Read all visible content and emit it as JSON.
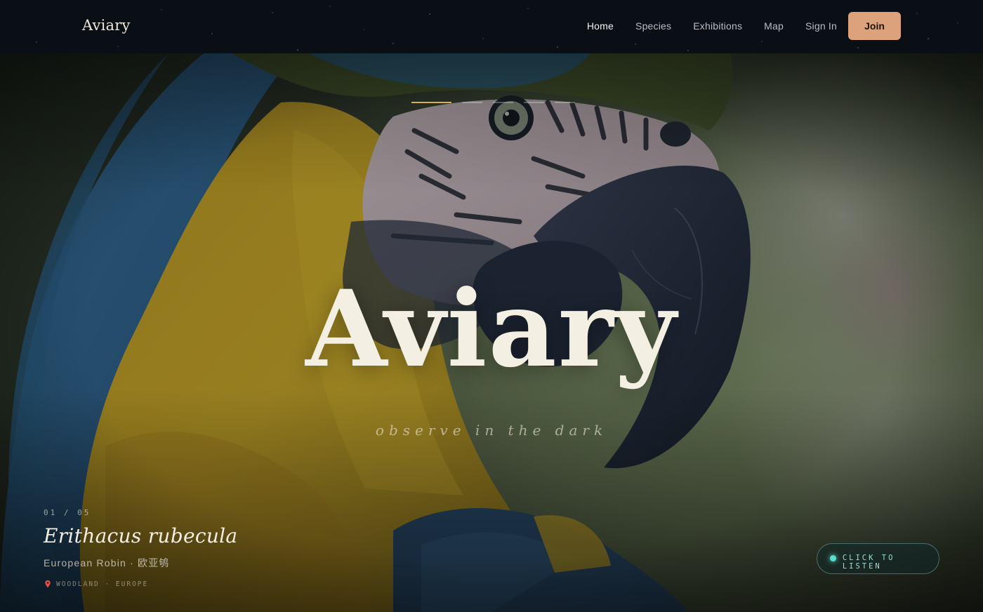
{
  "nav": {
    "brand": "Aviary",
    "links": [
      {
        "label": "Home",
        "active": true
      },
      {
        "label": "Species",
        "active": false
      },
      {
        "label": "Exhibitions",
        "active": false
      },
      {
        "label": "Map",
        "active": false
      },
      {
        "label": "Sign In",
        "active": false
      }
    ],
    "join_label": "Join"
  },
  "hero": {
    "title": "Aviary",
    "tagline": "observe in the dark",
    "slides_total": 5,
    "active_slide": 1
  },
  "species": {
    "counter": "01 / 05",
    "scientific_name": "Erithacus rubecula",
    "common_name": "European Robin · 欧亚鸲",
    "location": "WOODLAND · EUROPE"
  },
  "listen": {
    "label": "CLICK TO LISTEN"
  },
  "colors": {
    "accent": "#dba27b",
    "progress_active": "#d8b14a",
    "listen_accent": "#58e0d0",
    "nav_bg": "#0a0f15"
  },
  "icons": {
    "location": "map-pin-icon",
    "listen": "sound-dot-icon"
  }
}
